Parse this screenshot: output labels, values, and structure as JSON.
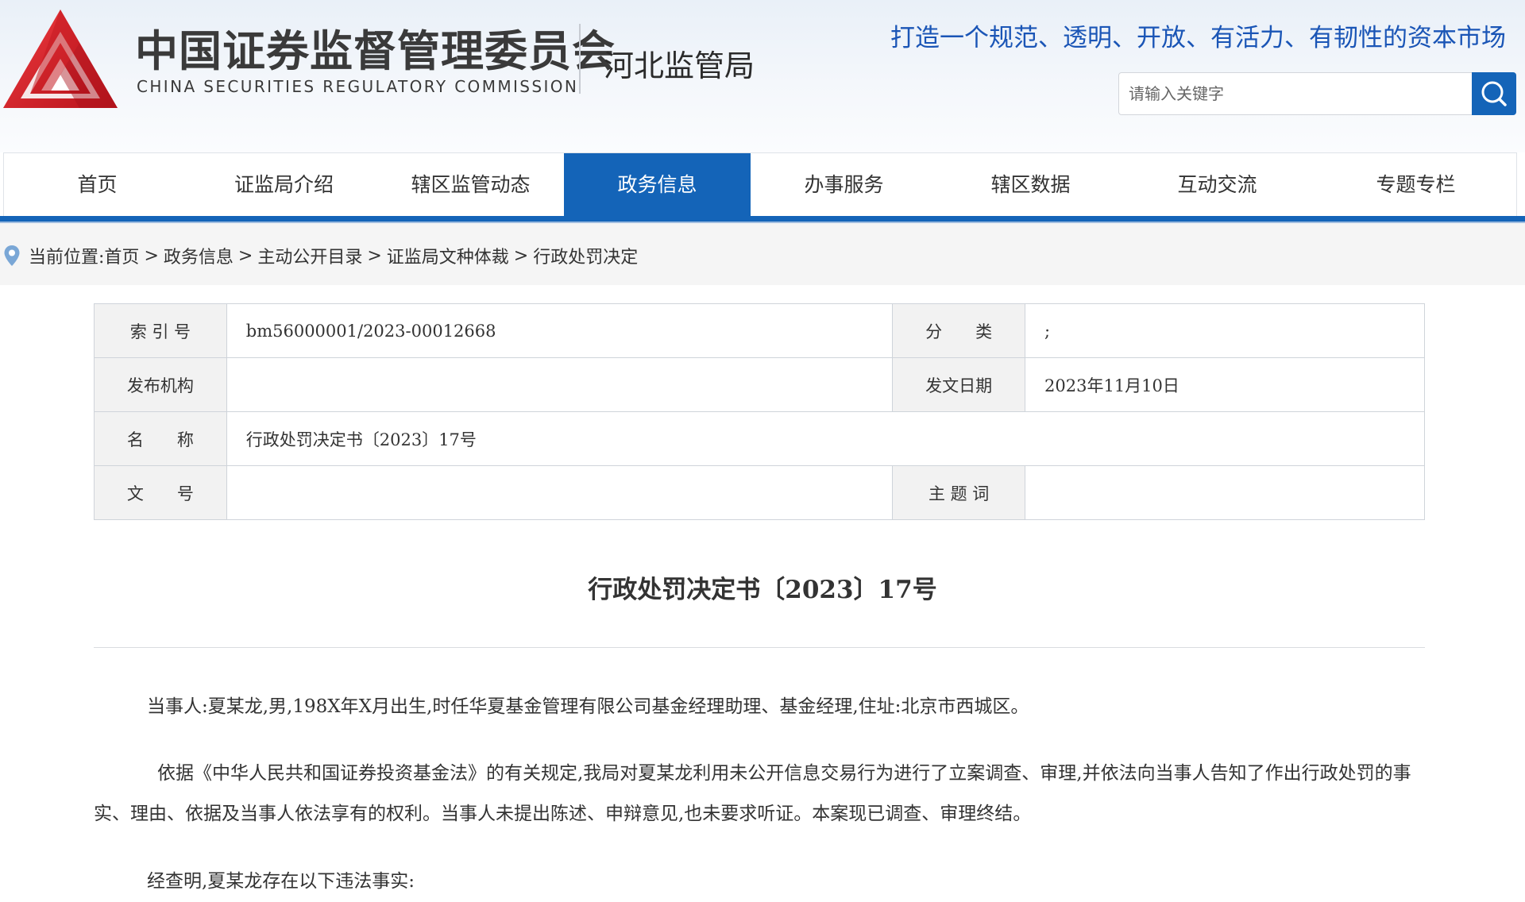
{
  "header": {
    "logo_cn": "中国证券监督管理委员会",
    "logo_en": "CHINA SECURITIES REGULATORY COMMISSION",
    "bureau": "河北监管局",
    "slogan": "打造一个规范、透明、开放、有活力、有韧性的资本市场",
    "search_placeholder": "请输入关键字",
    "brand_red": "#d9242c",
    "accent_blue": "#1464b8"
  },
  "nav": {
    "items": [
      {
        "label": "首页"
      },
      {
        "label": "证监局介绍"
      },
      {
        "label": "辖区监管动态"
      },
      {
        "label": "政务信息"
      },
      {
        "label": "办事服务"
      },
      {
        "label": "辖区数据"
      },
      {
        "label": "互动交流"
      },
      {
        "label": "专题专栏"
      }
    ],
    "active": "政务信息"
  },
  "breadcrumb": {
    "prefix": "当前位置:",
    "items": [
      "首页",
      "政务信息",
      "主动公开目录",
      "证监局文种体裁",
      "行政处罚决定"
    ],
    "separator": ">"
  },
  "info": {
    "index_label": "索 引 号",
    "index_value": "bm56000001/2023-00012668",
    "category_label": "分　　类",
    "category_value": ";",
    "publisher_label": "发布机构",
    "publisher_value": "",
    "date_label": "发文日期",
    "date_value": "2023年11月10日",
    "name_label": "名　　称",
    "name_value": "行政处罚决定书〔2023〕17号",
    "docno_label": "文　　号",
    "docno_value": "",
    "keywords_label": "主 题 词",
    "keywords_value": ""
  },
  "article": {
    "title": "行政处罚决定书〔2023〕17号",
    "paragraphs": [
      "当事人:夏某龙,男,198X年X月出生,时任华夏基金管理有限公司基金经理助理、基金经理,住址:北京市西城区。",
      "依据《中华人民共和国证券投资基金法》的有关规定,我局对夏某龙利用未公开信息交易行为进行了立案调查、审理,并依法向当事人告知了作出行政处罚的事实、理由、依据及当事人依法享有的权利。当事人未提出陈述、申辩意见,也未要求听证。本案现已调查、审理终结。",
      "经查明,夏某龙存在以下违法事实:"
    ]
  }
}
